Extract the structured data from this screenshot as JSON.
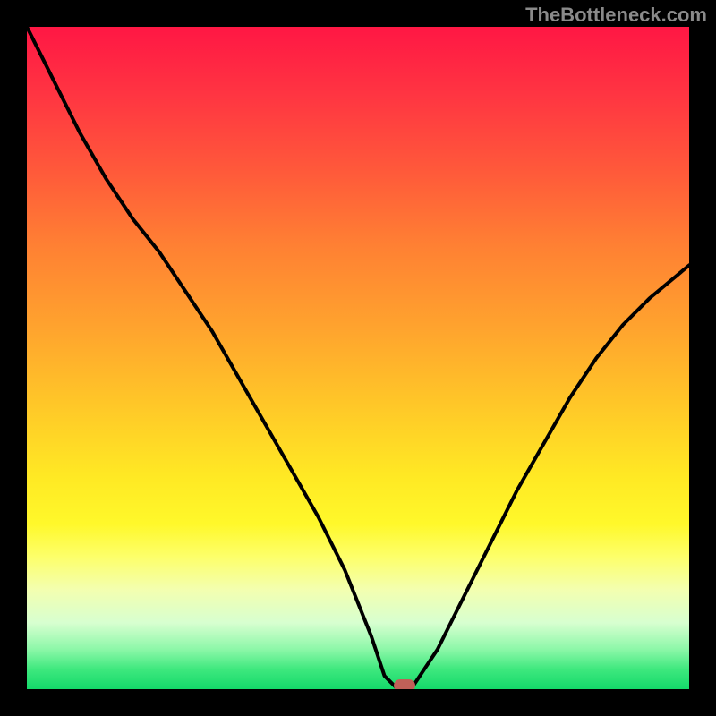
{
  "attribution": "TheBottleneck.com",
  "chart_data": {
    "type": "line",
    "title": "",
    "xlabel": "",
    "ylabel": "",
    "xlim": [
      0,
      100
    ],
    "ylim": [
      0,
      100
    ],
    "x": [
      0,
      4,
      8,
      12,
      16,
      20,
      24,
      28,
      32,
      36,
      40,
      44,
      48,
      52,
      54,
      56,
      58,
      62,
      66,
      70,
      74,
      78,
      82,
      86,
      90,
      94,
      100
    ],
    "y": [
      100,
      92,
      84,
      77,
      71,
      66,
      60,
      54,
      47,
      40,
      33,
      26,
      18,
      8,
      2,
      0,
      0,
      6,
      14,
      22,
      30,
      37,
      44,
      50,
      55,
      59,
      64
    ],
    "background_gradient": {
      "top": "#ff1744",
      "middle": "#ffe924",
      "bottom": "#14d96a"
    },
    "marker": {
      "x": 57,
      "y": 0.5,
      "color": "#c06058"
    }
  }
}
